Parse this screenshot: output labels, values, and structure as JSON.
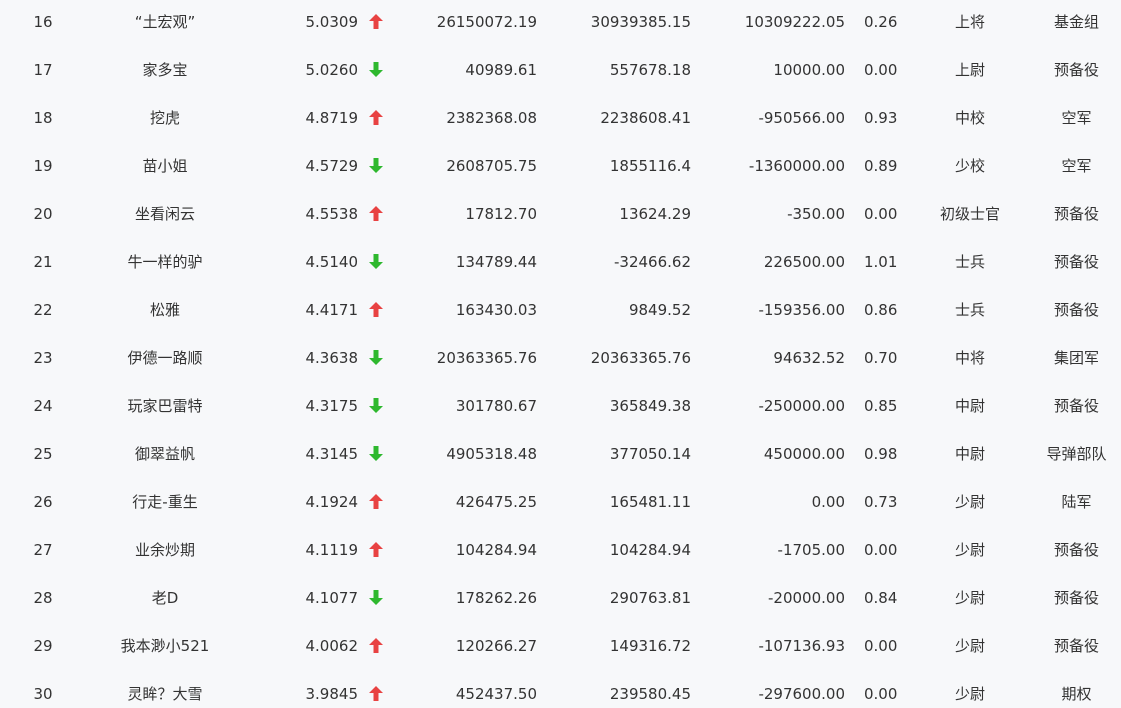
{
  "colors": {
    "up": "#e84242",
    "down": "#2eb82e"
  },
  "rows": [
    {
      "rank": "16",
      "name": "“土宏观”",
      "score": "5.0309",
      "trend": "up",
      "v1": "26150072.19",
      "v2": "30939385.15",
      "v3": "10309222.05",
      "ratio": "0.26",
      "title": "上将",
      "group": "基金组"
    },
    {
      "rank": "17",
      "name": "家多宝",
      "score": "5.0260",
      "trend": "down",
      "v1": "40989.61",
      "v2": "557678.18",
      "v3": "10000.00",
      "ratio": "0.00",
      "title": "上尉",
      "group": "预备役"
    },
    {
      "rank": "18",
      "name": "挖虎",
      "score": "4.8719",
      "trend": "up",
      "v1": "2382368.08",
      "v2": "2238608.41",
      "v3": "-950566.00",
      "ratio": "0.93",
      "title": "中校",
      "group": "空军"
    },
    {
      "rank": "19",
      "name": "苗小姐",
      "score": "4.5729",
      "trend": "down",
      "v1": "2608705.75",
      "v2": "1855116.4",
      "v3": "-1360000.00",
      "ratio": "0.89",
      "title": "少校",
      "group": "空军"
    },
    {
      "rank": "20",
      "name": "坐看闲云",
      "score": "4.5538",
      "trend": "up",
      "v1": "17812.70",
      "v2": "13624.29",
      "v3": "-350.00",
      "ratio": "0.00",
      "title": "初级士官",
      "group": "预备役"
    },
    {
      "rank": "21",
      "name": "牛一样的驴",
      "score": "4.5140",
      "trend": "down",
      "v1": "134789.44",
      "v2": "-32466.62",
      "v3": "226500.00",
      "ratio": "1.01",
      "title": "士兵",
      "group": "预备役"
    },
    {
      "rank": "22",
      "name": "松雅",
      "score": "4.4171",
      "trend": "up",
      "v1": "163430.03",
      "v2": "9849.52",
      "v3": "-159356.00",
      "ratio": "0.86",
      "title": "士兵",
      "group": "预备役"
    },
    {
      "rank": "23",
      "name": "伊德一路顺",
      "score": "4.3638",
      "trend": "down",
      "v1": "20363365.76",
      "v2": "20363365.76",
      "v3": "94632.52",
      "ratio": "0.70",
      "title": "中将",
      "group": "集团军"
    },
    {
      "rank": "24",
      "name": "玩家巴雷特",
      "score": "4.3175",
      "trend": "down",
      "v1": "301780.67",
      "v2": "365849.38",
      "v3": "-250000.00",
      "ratio": "0.85",
      "title": "中尉",
      "group": "预备役"
    },
    {
      "rank": "25",
      "name": "御翠益帆",
      "score": "4.3145",
      "trend": "down",
      "v1": "4905318.48",
      "v2": "377050.14",
      "v3": "450000.00",
      "ratio": "0.98",
      "title": "中尉",
      "group": "导弹部队"
    },
    {
      "rank": "26",
      "name": "行走-重生",
      "score": "4.1924",
      "trend": "up",
      "v1": "426475.25",
      "v2": "165481.11",
      "v3": "0.00",
      "ratio": "0.73",
      "title": "少尉",
      "group": "陆军"
    },
    {
      "rank": "27",
      "name": "业余炒期",
      "score": "4.1119",
      "trend": "up",
      "v1": "104284.94",
      "v2": "104284.94",
      "v3": "-1705.00",
      "ratio": "0.00",
      "title": "少尉",
      "group": "预备役"
    },
    {
      "rank": "28",
      "name": "老D",
      "score": "4.1077",
      "trend": "down",
      "v1": "178262.26",
      "v2": "290763.81",
      "v3": "-20000.00",
      "ratio": "0.84",
      "title": "少尉",
      "group": "预备役"
    },
    {
      "rank": "29",
      "name": "我本渺小521",
      "score": "4.0062",
      "trend": "up",
      "v1": "120266.27",
      "v2": "149316.72",
      "v3": "-107136.93",
      "ratio": "0.00",
      "title": "少尉",
      "group": "预备役"
    },
    {
      "rank": "30",
      "name": "灵眸？大雪",
      "score": "3.9845",
      "trend": "up",
      "v1": "452437.50",
      "v2": "239580.45",
      "v3": "-297600.00",
      "ratio": "0.00",
      "title": "少尉",
      "group": "期权"
    }
  ]
}
